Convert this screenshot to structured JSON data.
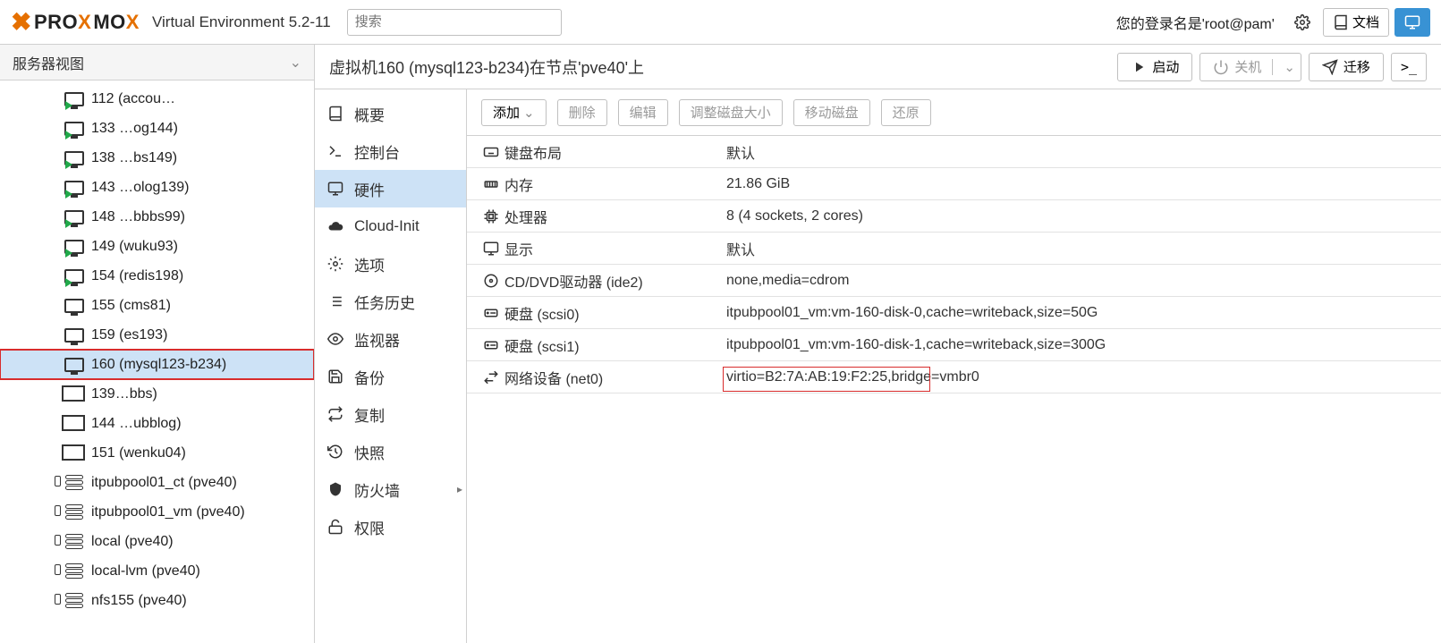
{
  "header": {
    "logo_left": "PRO",
    "logo_right": "MO",
    "version": "Virtual Environment 5.2-11",
    "search_placeholder": "搜索",
    "login_info": "您的登录名是'root@pam'",
    "docs_label": "文档"
  },
  "sidebar": {
    "view_label": "服务器视图",
    "items": [
      {
        "id": "112",
        "label": "112 (accou…",
        "icon": "vm-running",
        "blurpart": "…"
      },
      {
        "id": "133",
        "label": "133 …og144)",
        "icon": "vm-running",
        "blurpart": "…"
      },
      {
        "id": "138",
        "label": "138 …bs149)",
        "icon": "vm-running",
        "blurpart": "…"
      },
      {
        "id": "143",
        "label": "143 …olog139)",
        "icon": "vm-running",
        "blurpart": "…"
      },
      {
        "id": "148",
        "label": "148 …bbbs99)",
        "icon": "vm-running",
        "blurpart": "…"
      },
      {
        "id": "149",
        "label": "149 (wuku93)",
        "icon": "vm-running"
      },
      {
        "id": "154",
        "label": "154 (redis198)",
        "icon": "vm-running"
      },
      {
        "id": "155",
        "label": "155 (cms81)",
        "icon": "vm-stopped"
      },
      {
        "id": "159",
        "label": "159 (es193)",
        "icon": "vm-stopped"
      },
      {
        "id": "160",
        "label": "160 (mysql123-b234)",
        "icon": "vm-stopped",
        "selected": true,
        "highlight": true
      },
      {
        "id": "c139",
        "label": "139…bbs)",
        "icon": "ct",
        "blurpart": "…"
      },
      {
        "id": "c144",
        "label": "144 …ubblog)",
        "icon": "ct",
        "blurpart": "…"
      },
      {
        "id": "c151",
        "label": "151 (wenku04)",
        "icon": "ct"
      },
      {
        "id": "s1",
        "label": "itpubpool01_ct (pve40)",
        "icon": "storage"
      },
      {
        "id": "s2",
        "label": "itpubpool01_vm (pve40)",
        "icon": "storage"
      },
      {
        "id": "s3",
        "label": "local (pve40)",
        "icon": "storage"
      },
      {
        "id": "s4",
        "label": "local-lvm (pve40)",
        "icon": "storage"
      },
      {
        "id": "s5",
        "label": "nfs155 (pve40)",
        "icon": "storage"
      }
    ]
  },
  "main": {
    "title": "虚拟机160 (mysql123-b234)在节点'pve40'上",
    "start_label": "启动",
    "shutdown_label": "关机",
    "migrate_label": "迁移",
    "console_label": ">_"
  },
  "nav": {
    "items": [
      {
        "key": "summary",
        "label": "概要",
        "icon": "book"
      },
      {
        "key": "console",
        "label": "控制台",
        "icon": "terminal"
      },
      {
        "key": "hardware",
        "label": "硬件",
        "icon": "monitor",
        "active": true
      },
      {
        "key": "cloudinit",
        "label": "Cloud-Init",
        "icon": "cloud"
      },
      {
        "key": "options",
        "label": "选项",
        "icon": "gear"
      },
      {
        "key": "tasks",
        "label": "任务历史",
        "icon": "list"
      },
      {
        "key": "monitor",
        "label": "监视器",
        "icon": "eye"
      },
      {
        "key": "backup",
        "label": "备份",
        "icon": "save"
      },
      {
        "key": "replication",
        "label": "复制",
        "icon": "retweet"
      },
      {
        "key": "snapshots",
        "label": "快照",
        "icon": "history"
      },
      {
        "key": "firewall",
        "label": "防火墙",
        "icon": "shield",
        "hasSub": true
      },
      {
        "key": "perm",
        "label": "权限",
        "icon": "unlock"
      }
    ]
  },
  "toolbar": {
    "add": "添加",
    "remove": "删除",
    "edit": "编辑",
    "resize": "调整磁盘大小",
    "move": "移动磁盘",
    "revert": "还原"
  },
  "hardware": {
    "rows": [
      {
        "icon": "keyboard",
        "label": "键盘布局",
        "value": "默认"
      },
      {
        "icon": "memory",
        "label": "内存",
        "value": "21.86 GiB"
      },
      {
        "icon": "cpu",
        "label": "处理器",
        "value": "8 (4 sockets, 2 cores)"
      },
      {
        "icon": "display",
        "label": "显示",
        "value": "默认"
      },
      {
        "icon": "disc",
        "label": "CD/DVD驱动器 (ide2)",
        "value": "none,media=cdrom"
      },
      {
        "icon": "hdd",
        "label": "硬盘 (scsi0)",
        "value": "itpubpool01_vm:vm-160-disk-0,cache=writeback,size=50G"
      },
      {
        "icon": "hdd",
        "label": "硬盘 (scsi1)",
        "value": "itpubpool01_vm:vm-160-disk-1,cache=writeback,size=300G"
      },
      {
        "icon": "net",
        "label": "网络设备 (net0)",
        "value": "virtio=B2:7A:AB:19:F2:25,bridge=vmbr0",
        "highlight": true
      }
    ]
  }
}
